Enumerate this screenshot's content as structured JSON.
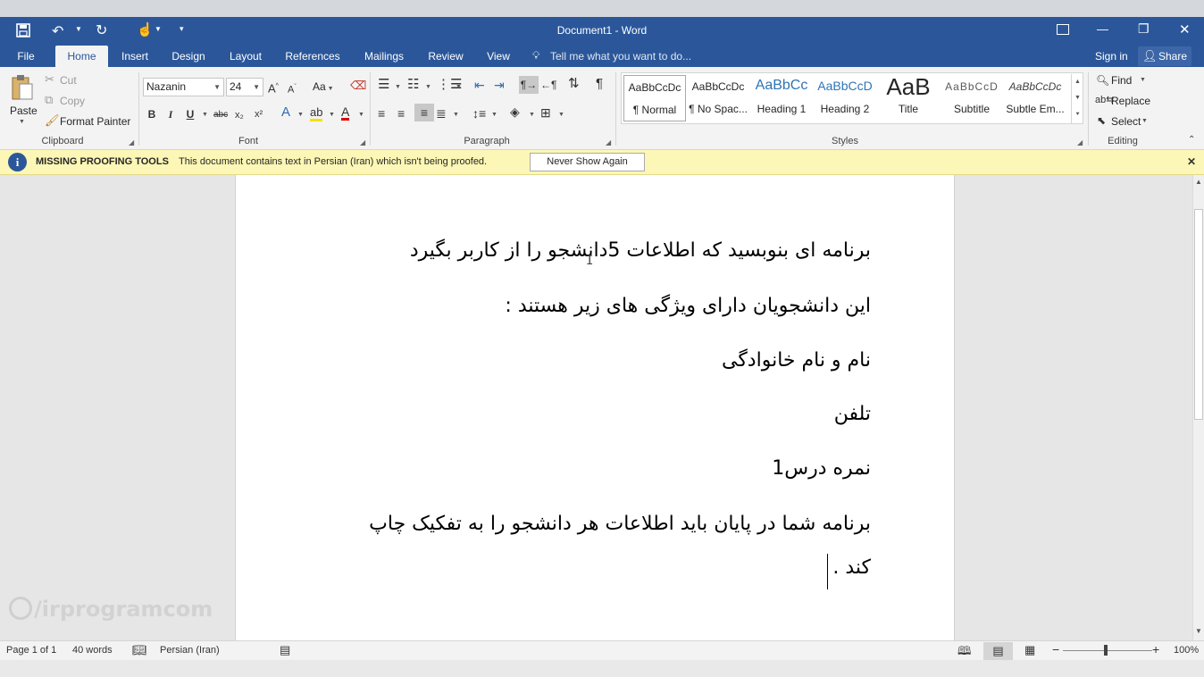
{
  "window": {
    "title": "Document1 - Word",
    "accent_color": "#2b579a"
  },
  "quick_access": {
    "save_icon": "save-icon",
    "undo_icon": "undo-icon",
    "redo_icon": "repeat-icon",
    "touch_icon": "touch-mode-icon",
    "customize_icon": "customize-qat-icon"
  },
  "window_controls": {
    "ribbon_options_icon": "ribbon-display-options-icon",
    "minimize": "—",
    "restore": "❐",
    "close": "✕"
  },
  "tabs": [
    {
      "label": "File"
    },
    {
      "label": "Home"
    },
    {
      "label": "Insert"
    },
    {
      "label": "Design"
    },
    {
      "label": "Layout"
    },
    {
      "label": "References"
    },
    {
      "label": "Mailings"
    },
    {
      "label": "Review"
    },
    {
      "label": "View"
    }
  ],
  "tell_me": "Tell me what you want to do...",
  "account": {
    "sign_in": "Sign in",
    "share": "Share"
  },
  "clipboard": {
    "paste": "Paste",
    "cut": "Cut",
    "copy": "Copy",
    "format_painter": "Format Painter",
    "label": "Clipboard"
  },
  "font": {
    "name": "Nazanin",
    "size": "24",
    "label": "Font",
    "change_case": "Aa",
    "bold": "B",
    "italic": "I",
    "underline": "U",
    "strikethrough": "abc",
    "subscript": "x₂",
    "superscript": "x²"
  },
  "paragraph": {
    "label": "Paragraph"
  },
  "styles": {
    "label": "Styles",
    "items": [
      {
        "sample": "AaBbCcDc",
        "name": "¶ Normal"
      },
      {
        "sample": "AaBbCcDc",
        "name": "¶ No Spac..."
      },
      {
        "sample": "AaBbCc",
        "name": "Heading 1"
      },
      {
        "sample": "AaBbCcD",
        "name": "Heading 2"
      },
      {
        "sample": "AaB",
        "name": "Title"
      },
      {
        "sample": "AaBbCcD",
        "name": "Subtitle"
      },
      {
        "sample": "AaBbCcDc",
        "name": "Subtle Em..."
      }
    ]
  },
  "editing": {
    "label": "Editing",
    "find": "Find",
    "replace": "Replace",
    "select": "Select"
  },
  "message_bar": {
    "title": "MISSING PROOFING TOOLS",
    "text": "This document contains text in Persian (Iran) which isn't being proofed.",
    "button": "Never Show Again",
    "close": "✕"
  },
  "document": {
    "paragraphs": [
      "برنامه ای بنوبسید که اطلاعات 5دانشجو را از کاربر بگیرد",
      "این دانشجویان دارای ویژگی های زیر  هستند :",
      "نام و نام خانوادگی",
      "تلفن",
      "نمره درس1",
      "برنامه شما در پایان باید اطلاعات هر دانشجو را به تفکیک چاپ",
      "کند ."
    ]
  },
  "watermark": "/irprogramcom",
  "status": {
    "page": "Page 1 of 1",
    "words": "40 words",
    "language": "Persian (Iran)",
    "zoom": "100%"
  }
}
